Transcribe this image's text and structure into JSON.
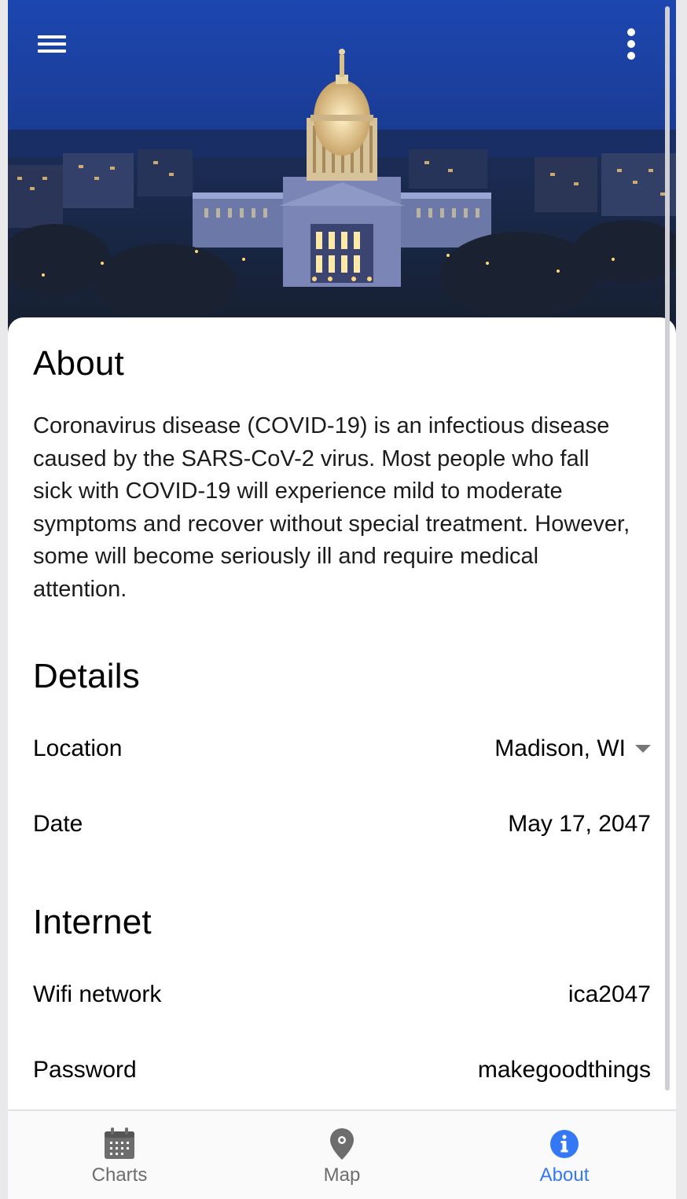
{
  "hero": {
    "image": "capitol-building-night-photo",
    "menu_icon": "hamburger-menu-icon",
    "more_icon": "more-vertical-icon"
  },
  "about": {
    "title": "About",
    "body": "Coronavirus disease (COVID-19) is an infectious disease caused by the SARS-CoV-2 virus. Most people who fall sick with COVID-19 will experience mild to moderate symptoms and recover without special treatment. However, some will become seriously ill and require medical attention."
  },
  "details": {
    "title": "Details",
    "location_label": "Location",
    "location_value": "Madison, WI",
    "date_label": "Date",
    "date_value": "May 17, 2047"
  },
  "internet": {
    "title": "Internet",
    "wifi_label": "Wifi network",
    "wifi_value": "ica2047",
    "password_label": "Password",
    "password_value": "makegoodthings"
  },
  "tabs": [
    {
      "label": "Charts",
      "icon": "calendar-icon",
      "active": false
    },
    {
      "label": "Map",
      "icon": "map-pin-icon",
      "active": false
    },
    {
      "label": "About",
      "icon": "info-icon",
      "active": true
    }
  ],
  "colors": {
    "accent": "#3478f6",
    "inactive_tab": "#6d6d6d",
    "sky": "#1d3f9a"
  }
}
